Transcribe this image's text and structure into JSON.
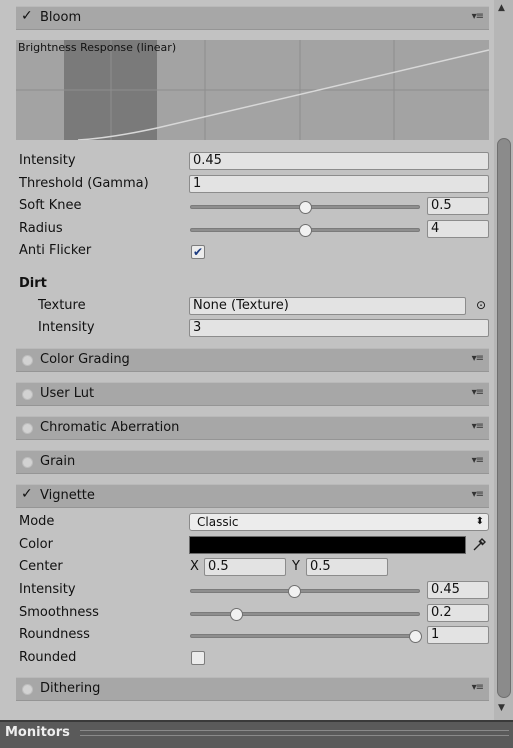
{
  "bloom": {
    "title": "Bloom",
    "check": "✓",
    "graph_title": "Brightness Response (linear)",
    "fields": {
      "intensity": {
        "label": "Intensity",
        "value": "0.45"
      },
      "threshold": {
        "label": "Threshold (Gamma)",
        "value": "1"
      },
      "soft_knee": {
        "label": "Soft Knee",
        "value": "0.5",
        "fraction": 0.5
      },
      "radius": {
        "label": "Radius",
        "value": "4",
        "fraction": 0.5
      },
      "anti_flicker": {
        "label": "Anti Flicker",
        "checked": true
      }
    },
    "dirt": {
      "heading": "Dirt",
      "texture_label": "Texture",
      "texture_value": "None (Texture)",
      "intensity_label": "Intensity",
      "intensity_value": "3"
    }
  },
  "sections": {
    "color_grading": "Color Grading",
    "user_lut": "User Lut",
    "chromatic_aberration": "Chromatic Aberration",
    "grain": "Grain",
    "dithering": "Dithering"
  },
  "vignette": {
    "title": "Vignette",
    "check": "✓",
    "mode_label": "Mode",
    "mode_value": "Classic",
    "color_label": "Color",
    "color_value": "#000000",
    "center_label": "Center",
    "center_x_label": "X",
    "center_x": "0.5",
    "center_y_label": "Y",
    "center_y": "0.5",
    "intensity_label": "Intensity",
    "intensity_value": "0.45",
    "intensity_fraction": 0.45,
    "smoothness_label": "Smoothness",
    "smoothness_value": "0.2",
    "smoothness_fraction": 0.2,
    "roundness_label": "Roundness",
    "roundness_value": "1",
    "roundness_fraction": 1.0,
    "rounded_label": "Rounded",
    "rounded_checked": false
  },
  "icons": {
    "menu": "▾≡",
    "checkmark": "✔",
    "object_picker": "⊙",
    "eyedropper": "eyedropper-icon",
    "dropdown_arrow": "⬍"
  },
  "monitors": {
    "title": "Monitors"
  }
}
